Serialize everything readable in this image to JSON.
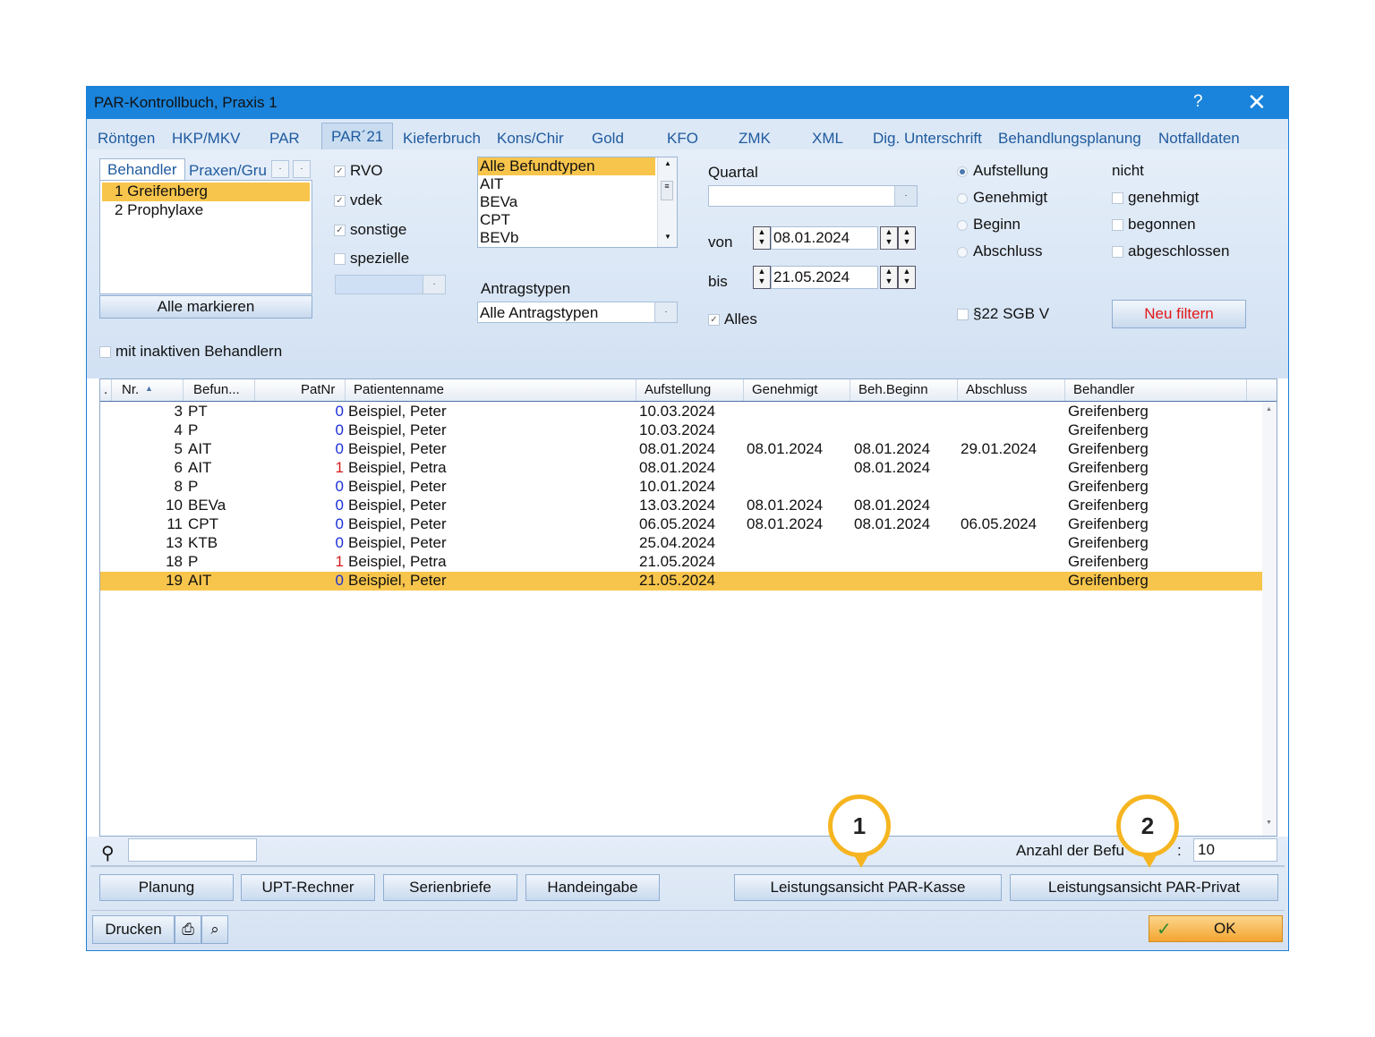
{
  "window": {
    "title": "PAR-Kontrollbuch, Praxis 1",
    "help_label": "?",
    "close_label": "✕"
  },
  "tabs": [
    "Röntgen",
    "HKP/MKV",
    "PAR",
    "PAR´21",
    "Kieferbruch",
    "Kons/Chir",
    "Gold",
    "KFO",
    "ZMK",
    "XML",
    "Dig. Unterschrift",
    "Behandlungsplanung",
    "Notfalldaten"
  ],
  "behandler_panel": {
    "tab_behandler": "Behandler",
    "tab_praxen": "Praxen/Gru",
    "items": [
      "1 Greifenberg",
      "2 Prophylaxe"
    ],
    "mark_all": "Alle markieren",
    "inactive_label": "mit inaktiven Behandlern"
  },
  "kassen": {
    "rvo": "RVO",
    "vdek": "vdek",
    "sonstige": "sonstige",
    "spezielle": "spezielle"
  },
  "befundtypen": {
    "items": [
      "Alle Befundtypen",
      "AIT",
      "BEVa",
      "CPT",
      "BEVb"
    ],
    "antragstypen_label": "Antragstypen",
    "antragstypen_value": "Alle Antragstypen"
  },
  "zeitraum": {
    "quartal_label": "Quartal",
    "von_label": "von",
    "von_value": "08.01.2024",
    "bis_label": "bis",
    "bis_value": "21.05.2024",
    "alles_label": "Alles"
  },
  "status": {
    "aufstellung": "Aufstellung",
    "genehmigt": "Genehmigt",
    "beginn": "Beginn",
    "abschluss": "Abschluss",
    "nicht_label": "nicht",
    "nicht_genehmigt": "genehmigt",
    "nicht_begonnen": "begonnen",
    "nicht_abgeschlossen": "abgeschlossen",
    "sgb": "§22 SGB V",
    "neu_filtern": "Neu filtern"
  },
  "table": {
    "headers": [
      ".",
      "Nr.",
      "Befun...",
      "PatNr",
      "Patientenname",
      "Aufstellung",
      "Genehmigt",
      "Beh.Beginn",
      "Abschluss",
      "Behandler"
    ],
    "rows": [
      {
        "nr": "3",
        "befund": "PT",
        "patnr": "0",
        "name": "Beispiel, Peter",
        "aufstellung": "10.03.2024",
        "genehmigt": "",
        "beginn": "",
        "abschluss": "",
        "behandler": "Greifenberg"
      },
      {
        "nr": "4",
        "befund": "P",
        "patnr": "0",
        "name": "Beispiel, Peter",
        "aufstellung": "10.03.2024",
        "genehmigt": "",
        "beginn": "",
        "abschluss": "",
        "behandler": "Greifenberg"
      },
      {
        "nr": "5",
        "befund": "AIT",
        "patnr": "0",
        "name": "Beispiel, Peter",
        "aufstellung": "08.01.2024",
        "genehmigt": "08.01.2024",
        "beginn": "08.01.2024",
        "abschluss": "29.01.2024",
        "behandler": "Greifenberg"
      },
      {
        "nr": "6",
        "befund": "AIT",
        "patnr": "1",
        "name": "Beispiel, Petra",
        "aufstellung": "08.01.2024",
        "genehmigt": "",
        "beginn": "08.01.2024",
        "abschluss": "",
        "behandler": "Greifenberg"
      },
      {
        "nr": "8",
        "befund": "P",
        "patnr": "0",
        "name": "Beispiel, Peter",
        "aufstellung": "10.01.2024",
        "genehmigt": "",
        "beginn": "",
        "abschluss": "",
        "behandler": "Greifenberg"
      },
      {
        "nr": "10",
        "befund": "BEVa",
        "patnr": "0",
        "name": "Beispiel, Peter",
        "aufstellung": "13.03.2024",
        "genehmigt": "08.01.2024",
        "beginn": "08.01.2024",
        "abschluss": "",
        "behandler": "Greifenberg"
      },
      {
        "nr": "11",
        "befund": "CPT",
        "patnr": "0",
        "name": "Beispiel, Peter",
        "aufstellung": "06.05.2024",
        "genehmigt": "08.01.2024",
        "beginn": "08.01.2024",
        "abschluss": "06.05.2024",
        "behandler": "Greifenberg"
      },
      {
        "nr": "13",
        "befund": "KTB",
        "patnr": "0",
        "name": "Beispiel, Peter",
        "aufstellung": "25.04.2024",
        "genehmigt": "",
        "beginn": "",
        "abschluss": "",
        "behandler": "Greifenberg"
      },
      {
        "nr": "18",
        "befund": "P",
        "patnr": "1",
        "name": "Beispiel, Petra",
        "aufstellung": "21.05.2024",
        "genehmigt": "",
        "beginn": "",
        "abschluss": "",
        "behandler": "Greifenberg"
      },
      {
        "nr": "19",
        "befund": "AIT",
        "patnr": "0",
        "name": "Beispiel, Peter",
        "aufstellung": "21.05.2024",
        "genehmigt": "",
        "beginn": "",
        "abschluss": "",
        "behandler": "Greifenberg",
        "selected": true
      }
    ]
  },
  "footer": {
    "search_value": "",
    "anzahl_label": "Anzahl der Befu",
    "anzahl_suffix": ":",
    "anzahl_value": "10",
    "buttons": [
      "Planung",
      "UPT-Rechner",
      "Serienbriefe",
      "Handeingabe",
      "Leistungsansicht PAR-Kasse",
      "Leistungsansicht PAR-Privat"
    ],
    "drucken": "Drucken",
    "ok": "OK"
  },
  "callouts": [
    "1",
    "2"
  ],
  "colors": {
    "title_bar": "#1a84dc",
    "selection": "#f8c54c",
    "link_blue": "#1f5a9e",
    "patnr_zero": "#1a2fd6",
    "patnr_one": "#d61a1a",
    "neu_filtern": "#e01818",
    "callout": "#f6b520"
  }
}
